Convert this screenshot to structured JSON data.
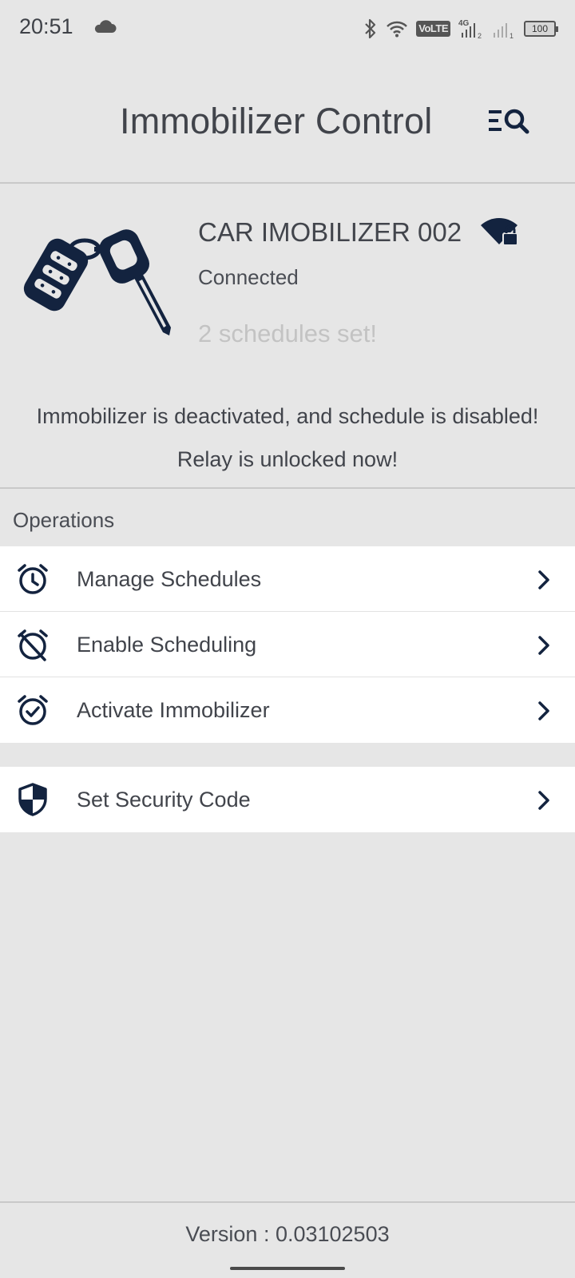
{
  "status_bar": {
    "time": "20:51",
    "network_label": "VoLTE",
    "signal_label": "4G",
    "battery": "100"
  },
  "header": {
    "title": "Immobilizer Control"
  },
  "device": {
    "name": "CAR IMOBILIZER 002",
    "status": "Connected",
    "schedules": "2 schedules set!",
    "message": "Immobilizer is deactivated, and schedule is disabled!",
    "relay": "Relay is unlocked now!"
  },
  "operations": {
    "label": "Operations",
    "items": [
      {
        "label": "Manage Schedules",
        "icon": "alarm-clock-icon"
      },
      {
        "label": "Enable Scheduling",
        "icon": "alarm-off-icon"
      },
      {
        "label": "Activate Immobilizer",
        "icon": "alarm-check-icon"
      }
    ]
  },
  "security": {
    "items": [
      {
        "label": "Set Security Code",
        "icon": "shield-icon"
      }
    ]
  },
  "footer": {
    "version": "Version : 0.03102503"
  },
  "colors": {
    "background": "#e6e6e6",
    "navy": "#13233f",
    "text": "#41444b",
    "muted": "#c3c3c3"
  }
}
